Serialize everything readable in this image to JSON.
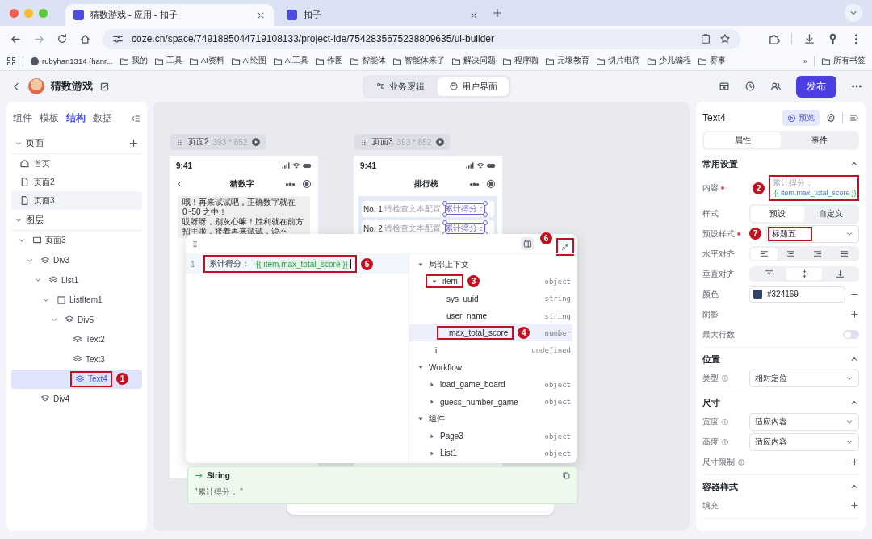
{
  "browser": {
    "tabs": [
      {
        "title": "猜数游戏 - 应用 - 扣子",
        "selected": true
      },
      {
        "title": "扣子",
        "selected": false
      }
    ],
    "url": "coze.cn/space/7491885044719108133/project-ide/7542835675238809635/ui-builder",
    "bookmarks": [
      {
        "label": "rubyhan1314 (hanr...",
        "kind": "github"
      },
      {
        "label": "我的",
        "kind": "folder"
      },
      {
        "label": "工具",
        "kind": "folder"
      },
      {
        "label": "AI资料",
        "kind": "folder"
      },
      {
        "label": "AI绘图",
        "kind": "folder"
      },
      {
        "label": "AI工具",
        "kind": "folder"
      },
      {
        "label": "作图",
        "kind": "folder"
      },
      {
        "label": "智能体",
        "kind": "folder"
      },
      {
        "label": "智能体来了",
        "kind": "folder"
      },
      {
        "label": "解决问题",
        "kind": "folder"
      },
      {
        "label": "程序咖",
        "kind": "folder"
      },
      {
        "label": "元壤教育",
        "kind": "folder"
      },
      {
        "label": "切片电商",
        "kind": "folder"
      },
      {
        "label": "少儿编程",
        "kind": "folder"
      },
      {
        "label": "赛事",
        "kind": "folder"
      }
    ],
    "bookmarks_overflow": "»",
    "all_bookmarks": "所有书签"
  },
  "app_header": {
    "title": "猜数游戏",
    "modes": [
      {
        "label": "业务逻辑",
        "kind": "logic",
        "selected": false
      },
      {
        "label": "用户界面",
        "kind": "ui",
        "selected": true
      }
    ],
    "publish": "发布"
  },
  "left_panel": {
    "tabs": [
      {
        "label": "组件",
        "selected": false
      },
      {
        "label": "模板",
        "selected": false
      },
      {
        "label": "结构",
        "selected": true
      },
      {
        "label": "数据",
        "selected": false
      }
    ],
    "pages_heading": "页面",
    "pages": [
      {
        "label": "首页",
        "kind": "home",
        "selected": false
      },
      {
        "label": "页面2",
        "kind": "page",
        "selected": false
      },
      {
        "label": "页面3",
        "kind": "page",
        "selected": true
      }
    ],
    "layers_heading": "图层",
    "layers": [
      {
        "label": "页面3",
        "kind": "screen",
        "expanded": true,
        "selected": false,
        "children": [
          {
            "label": "Div3",
            "kind": "stack",
            "expanded": true,
            "selected": false,
            "children": [
              {
                "label": "List1",
                "kind": "stack",
                "expanded": true,
                "selected": false,
                "children": [
                  {
                    "label": "ListItem1",
                    "kind": "item",
                    "expanded": true,
                    "selected": false,
                    "children": [
                      {
                        "label": "Div5",
                        "kind": "stack",
                        "expanded": true,
                        "selected": false,
                        "children": [
                          {
                            "label": "Text2",
                            "kind": "stack",
                            "selected": false
                          },
                          {
                            "label": "Text3",
                            "kind": "stack",
                            "selected": false
                          },
                          {
                            "label": "Text4",
                            "kind": "stack",
                            "selected": true,
                            "callout": "1"
                          }
                        ]
                      }
                    ]
                  }
                ]
              }
            ]
          },
          {
            "label": "Div4",
            "kind": "stack",
            "selected": false
          }
        ]
      }
    ]
  },
  "canvas": {
    "frames": [
      {
        "name": "页面2",
        "size": "393 * 852",
        "time": "9:41",
        "title": "猜数字",
        "kind": "chat",
        "messages": [
          "哦！再来试试吧，正确数字就在0~50 之中！",
          "哎呀呀，别灰心嘛！胜利就在前方招手啦，接着再来试试，说不"
        ]
      },
      {
        "name": "页面3",
        "size": "393 * 852",
        "time": "9:41",
        "title": "排行榜",
        "kind": "list",
        "rows": [
          {
            "rank": "No. 1",
            "name": "请检查文本配置",
            "score": "累计得分："
          },
          {
            "rank": "No. 2",
            "name": "请检查文本配置",
            "score": "累计得分："
          }
        ]
      }
    ]
  },
  "expression_editor": {
    "line_number": "1",
    "text": "累计得分：",
    "expression": "{{ item.max_total_score }}",
    "callout": "5",
    "collapse_callout": "6",
    "variables": [
      {
        "label": "局部上下文",
        "expanded": true,
        "selected": false,
        "children": [
          {
            "label": "item",
            "type": "object",
            "expanded": true,
            "selected": false,
            "callout": "3",
            "children": [
              {
                "label": "sys_uuid",
                "type": "string",
                "selected": false
              },
              {
                "label": "user_name",
                "type": "string",
                "selected": false
              },
              {
                "label": "max_total_score",
                "type": "number",
                "selected": true,
                "callout": "4"
              }
            ]
          },
          {
            "label": "i",
            "type": "undefined",
            "selected": false
          }
        ]
      },
      {
        "label": "Workflow",
        "expanded": true,
        "selected": false,
        "children": [
          {
            "label": "load_game_board",
            "type": "object",
            "expanded": false,
            "selected": false
          },
          {
            "label": "guess_number_game",
            "type": "object",
            "expanded": false,
            "selected": false
          }
        ]
      },
      {
        "label": "组件",
        "expanded": true,
        "selected": false,
        "children": [
          {
            "label": "Page3",
            "type": "object",
            "expanded": false,
            "selected": false
          },
          {
            "label": "List1",
            "type": "object",
            "expanded": false,
            "selected": false
          }
        ]
      }
    ]
  },
  "result": {
    "type": "String",
    "value": "\"累计得分： \""
  },
  "right_panel": {
    "component": "Text4",
    "preview": "预览",
    "tabs": [
      {
        "label": "属性",
        "selected": true
      },
      {
        "label": "事件",
        "selected": false
      }
    ],
    "sections": [
      {
        "title": "常用设置",
        "expanded": true,
        "rows": [
          {
            "kind": "content",
            "label": "内容",
            "required": true,
            "text": "累计得分：",
            "expression_open": "{{",
            "expression": "item.max_total_score",
            "expression_close": "}}",
            "callout": "2"
          },
          {
            "kind": "segmented",
            "label": "样式",
            "options": [
              {
                "label": "预设",
                "selected": true
              },
              {
                "label": "自定义",
                "selected": false
              }
            ]
          },
          {
            "kind": "select",
            "label": "预设样式",
            "required": true,
            "value": "标题五",
            "callout": "7"
          },
          {
            "kind": "icons",
            "label": "水平对齐",
            "options": [
              {
                "kind": "left",
                "selected": true
              },
              {
                "kind": "center",
                "selected": false
              },
              {
                "kind": "right",
                "selected": false
              },
              {
                "kind": "justify",
                "selected": false
              }
            ]
          },
          {
            "kind": "icons",
            "label": "垂直对齐",
            "options": [
              {
                "kind": "top",
                "selected": false
              },
              {
                "kind": "middle",
                "selected": true
              },
              {
                "kind": "bottom",
                "selected": false
              }
            ]
          },
          {
            "kind": "color",
            "label": "颜色",
            "value": "#324169",
            "color": "#324169"
          },
          {
            "kind": "add",
            "label": "阴影"
          },
          {
            "kind": "toggle",
            "label": "最大行数",
            "on": false
          }
        ]
      },
      {
        "title": "位置",
        "expanded": true,
        "rows": [
          {
            "kind": "select",
            "label": "类型",
            "info": true,
            "value": "相对定位"
          }
        ]
      },
      {
        "title": "尺寸",
        "expanded": true,
        "rows": [
          {
            "kind": "select",
            "label": "宽度",
            "info": true,
            "value": "适应内容"
          },
          {
            "kind": "select",
            "label": "高度",
            "info": true,
            "value": "适应内容"
          },
          {
            "kind": "add",
            "label": "尺寸限制",
            "info": true
          }
        ]
      },
      {
        "title": "容器样式",
        "expanded": true,
        "rows": [
          {
            "kind": "add",
            "label": "填充"
          }
        ]
      }
    ]
  }
}
